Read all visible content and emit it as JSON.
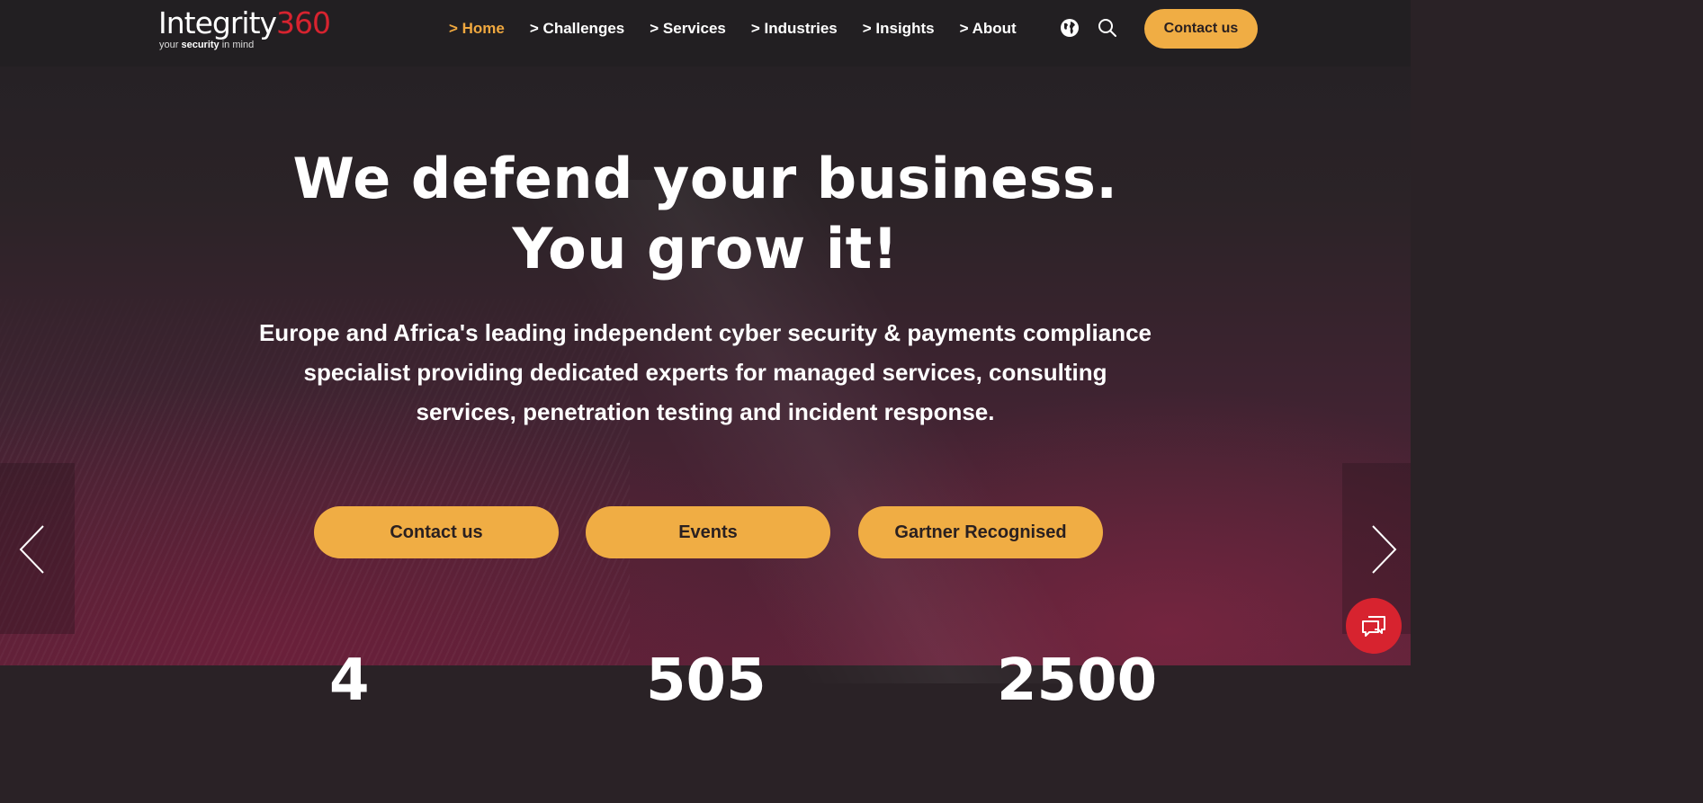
{
  "brand": {
    "logo_word": "Integrity",
    "logo_number": "360",
    "tagline_pre": "your ",
    "tagline_bold": "security",
    "tagline_post": " in mind"
  },
  "nav": {
    "items": [
      {
        "label": "> Home",
        "active": true
      },
      {
        "label": "> Challenges",
        "active": false
      },
      {
        "label": "> Services",
        "active": false
      },
      {
        "label": "> Industries",
        "active": false
      },
      {
        "label": "> Insights",
        "active": false
      },
      {
        "label": "> About",
        "active": false
      }
    ],
    "icons": [
      "globe-icon",
      "search-icon"
    ],
    "cta_label": "Contact us"
  },
  "hero": {
    "title_line1": "We defend your business.",
    "title_line2": "You grow it!",
    "subtitle": "Europe and Africa's leading independent cyber security & payments compliance  specialist providing dedicated experts for managed services, consulting services, penetration testing and incident response.",
    "buttons": [
      "Contact us",
      "Events",
      "Gartner Recognised"
    ],
    "stats": [
      "4",
      "505",
      "2500"
    ]
  },
  "colors": {
    "accent": "#f0ad44",
    "nav_active": "#f0a83f",
    "brand_red": "#d7232f",
    "header_bg": "#221f22"
  },
  "chat": {
    "icon": "chat-icon"
  }
}
